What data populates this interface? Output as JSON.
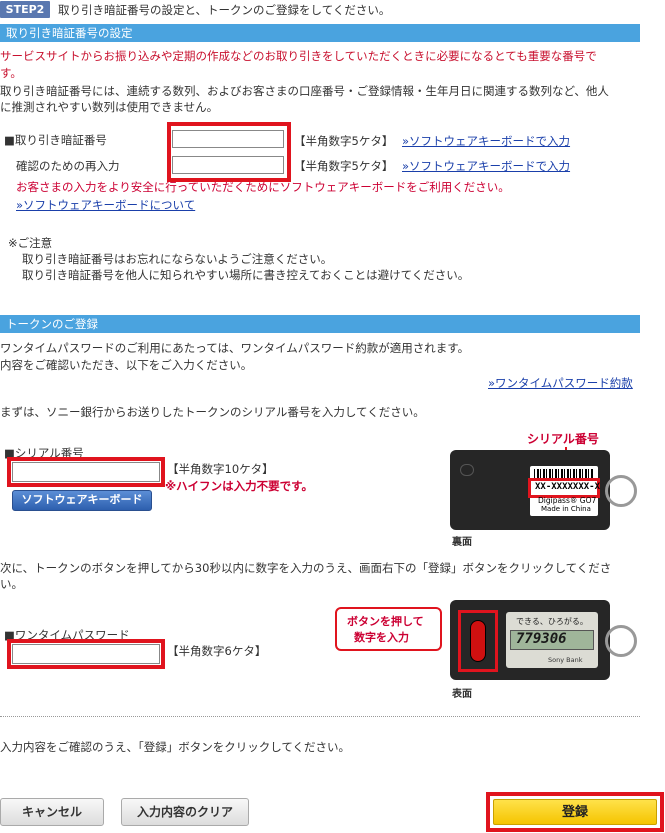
{
  "step": {
    "badge": "STEP2",
    "text": "取り引き暗証番号の設定と、トークンのご登録をしてください。"
  },
  "pin_section": {
    "title": "取り引き暗証番号の設定",
    "intro_red_1": "サービスサイトからお振り込みや定期の作成などのお取り引きをしていただくときに必要になるとても重要な番号で",
    "intro_red_2": "す。",
    "intro_1": "取り引き暗証番号には、連続する数列、およびお客さまの口座番号・ご登録情報・生年月日に関連する数列など、他人",
    "intro_2": "に推測されやすい数列は使用できません。",
    "pin_label": "■取り引き暗証番号",
    "confirm_label": "確認のための再入力",
    "hint": "【半角数字5ケタ】",
    "soft_kb_link": "»ソフトウェアキーボードで入力",
    "security_note": "お客さまの入力をより安全に行っていただくためにソフトウェアキーボードをご利用ください。",
    "about_link": "»ソフトウェアキーボードについて",
    "caution_title": "※ご注意",
    "caution_1": "取り引き暗証番号はお忘れにならないようご注意ください。",
    "caution_2": "取り引き暗証番号を他人に知られやすい場所に書き控えておくことは避けてください。"
  },
  "token_section": {
    "title": "トークンのご登録",
    "intro_1": "ワンタイムパスワードのご利用にあたっては、ワンタイムパスワード約款が適用されます。",
    "intro_2": "内容をご確認いただき、以下をご入力ください。",
    "terms_link": "»ワンタイムパスワード約款",
    "serial_intro": "まずは、ソニー銀行からお送りしたトークンのシリアル番号を入力してください。",
    "serial_label": "■シリアル番号",
    "serial_hint": "【半角数字10ケタ】",
    "serial_note": "※ハイフンは入力不要です。",
    "soft_kb_button": "ソフトウェアキーボード",
    "back_callout": "シリアル番号",
    "back_serial": "XX-XXXXXXX-X",
    "back_brand": "Digipass® GO7",
    "back_made": "Made in China",
    "back_caption": "裏面",
    "otp_intro_1": "次に、トークンのボタンを押してから30秒以内に数字を入力のうえ、画面右下の「登録」ボタンをクリックしてくださ",
    "otp_intro_2": "い。",
    "otp_label": "■ワンタイムパスワード",
    "otp_hint": "【半角数字6ケタ】",
    "callout_1": "ボタンを押して",
    "callout_2": "数字を入力",
    "front_lcd_top": "できる、ひろがる。",
    "front_lcd_num": "779306",
    "front_brand": "Sony Bank",
    "front_caption": "表面"
  },
  "footer": {
    "confirm_text": "入力内容をご確認のうえ、「登録」ボタンをクリックしてください。",
    "cancel": "キャンセル",
    "clear": "入力内容のクリア",
    "register": "登録"
  },
  "colors": {
    "section_bar": "#4aa3df",
    "highlight_red": "#e0141e",
    "register_yellow": "#ffd300"
  }
}
